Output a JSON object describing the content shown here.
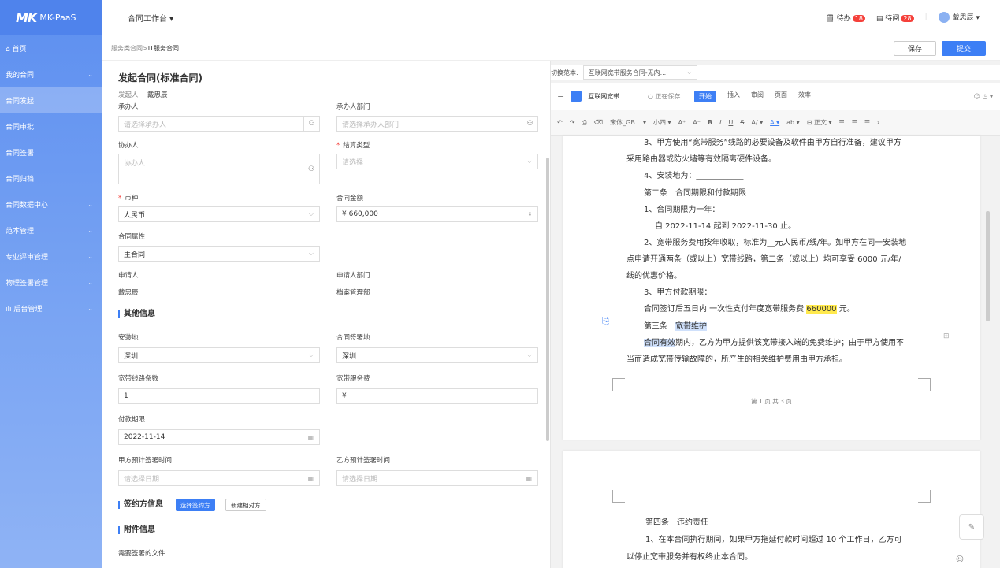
{
  "app": {
    "logo_mark": "MK",
    "logo_text": "MK-PaaS"
  },
  "sidebar": {
    "items": [
      {
        "label": "⌂ 首页",
        "chevron": ""
      },
      {
        "label": "我的合同",
        "chevron": "⌄"
      },
      {
        "label": "合同发起",
        "chevron": ""
      },
      {
        "label": "合同审批",
        "chevron": ""
      },
      {
        "label": "合同签署",
        "chevron": ""
      },
      {
        "label": "合同归档",
        "chevron": ""
      },
      {
        "label": "合同数据中心",
        "chevron": "⌄"
      },
      {
        "label": "范本管理",
        "chevron": "⌄"
      },
      {
        "label": "专业评审管理",
        "chevron": "⌄"
      },
      {
        "label": "物理签署管理",
        "chevron": "⌄"
      },
      {
        "label": "ili 后台管理",
        "chevron": "⌄"
      }
    ]
  },
  "topbar": {
    "workspace": "合同工作台 ▾",
    "todo_label": "待办",
    "todo_count": "18",
    "toread_label": "待阅",
    "toread_count": "28",
    "user": "戴思辰 ▾"
  },
  "breadcrumb": {
    "parent": "服务类合同",
    "sep": " > ",
    "current": "IT服务合同"
  },
  "actions": {
    "save": "保存",
    "submit": "提交"
  },
  "form": {
    "title": "发起合同(标准合同)",
    "initiator_label": "发起人",
    "initiator": "戴思辰",
    "undertaker_label": "承办人",
    "undertaker_ph": "请选择承办人",
    "undertaker_dept_label": "承办人部门",
    "undertaker_dept_ph": "请选择承办人部门",
    "co_label": "协办人",
    "co_ph": "协办人",
    "settle_label": "结算类型",
    "settle_ph": "请选择",
    "currency_label": "币种",
    "currency": "人民币",
    "amount_label": "合同金额",
    "amount": "¥ 660,000",
    "attr_label": "合同属性",
    "attr": "主合同",
    "applicant_label": "申请人",
    "applicant": "戴思辰",
    "applicant_dept_label": "申请人部门",
    "applicant_dept": "档案管理部",
    "other_section": "其他信息",
    "install_label": "安装地",
    "install": "深圳",
    "sign_place_label": "合同签署地",
    "sign_place": "深圳",
    "lines_label": "宽带线路条数",
    "lines": "1",
    "fee_label": "宽带服务费",
    "fee": "¥",
    "term_label": "付款期限",
    "term": "2022-11-14",
    "a_time_label": "甲方预计签署时间",
    "a_time_ph": "请选择日期",
    "b_time_label": "乙方预计签署时间",
    "b_time_ph": "请选择日期",
    "signer_section": "签约方信息",
    "pick_signer": "选择签约方",
    "new_party": "新建相对方",
    "attach_section": "附件信息",
    "attach_label": "需要签署的文件"
  },
  "doc": {
    "switch_label": "切换范本:",
    "switch_value": "互联网宽带服务合同-无内...",
    "doc_name": "互联网宽带...",
    "saving": "正在保存...",
    "tabs": [
      "开始",
      "插入",
      "审阅",
      "页面",
      "效率"
    ],
    "font": "宋体_GB...",
    "size": "小四",
    "body_style": "正文",
    "page1": [
      "3、甲方使用“宽带服务”线路的必要设备及软件由甲方自行准备，建议甲方",
      "采用路由器或防火墙等有效隔离硬件设备。",
      "4、安装地为：____________",
      "第二条　合同期限和付款期限",
      "1、合同期限为一年：",
      "自 2022-11-14 起到 2022-11-30 止。",
      "2、宽带服务费用按年收取，标准为__元人民币/线/年。如甲方在同一安装地",
      "点申请开通两条（或以上）宽带线路，第二条（或以上）均可享受 6000 元/年/",
      "线的优惠价格。",
      "3、甲方付款期限：",
      "合同签订后五日内 一次性支付年度宽带服务费 ",
      "660000",
      " 元。",
      "第三条　",
      "宽带维护",
      "合同有效",
      "期内，乙方为甲方提供该宽带接入端的免费维护；由于甲方使用不",
      "当而造成宽带传输故障的，所产生的相关维护费用由甲方承担。"
    ],
    "page_footer": "第 1 页 共 3 页",
    "page2": [
      "第四条　违约责任",
      "1、在本合同执行期间，如果甲方拖延付款时间超过 10 个工作日，乙方可",
      "以停止宽带服务并有权终止本合同。"
    ]
  },
  "colors": {
    "accent": "#3d7ff5",
    "sidebar": "#5d8ff0",
    "highlight": "#ffe94d"
  }
}
